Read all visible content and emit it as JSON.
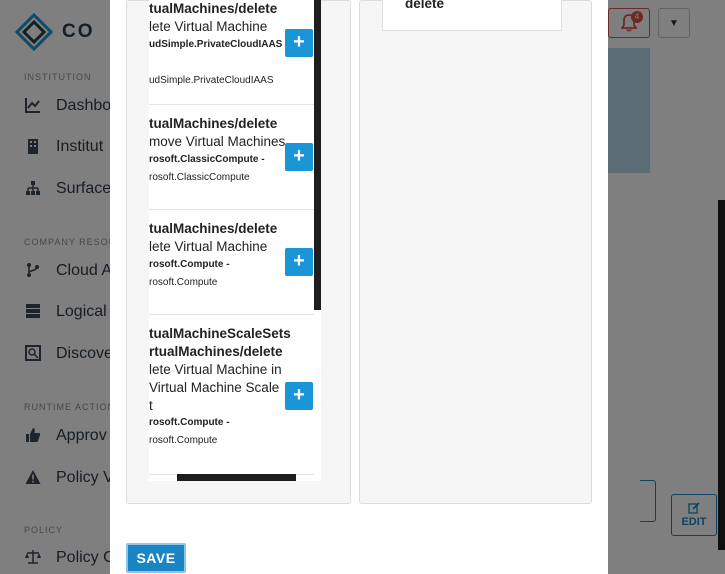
{
  "app": {
    "logo_text": "CO",
    "sidebar": {
      "sections": [
        {
          "title": "INSTITUTION",
          "items": [
            {
              "label": "Dashbo",
              "icon": "chart-line-icon"
            },
            {
              "label": "Institut",
              "icon": "building-icon"
            },
            {
              "label": "Surface",
              "icon": "sitemap-icon"
            }
          ]
        },
        {
          "title": "COMPANY RESOU",
          "items": [
            {
              "label": "Cloud A",
              "icon": "branch-icon"
            },
            {
              "label": "Logical",
              "icon": "server-icon"
            },
            {
              "label": "Discove",
              "icon": "discover-icon"
            }
          ]
        },
        {
          "title": "RUNTIME ACTION",
          "items": [
            {
              "label": "Approv",
              "icon": "thumbs-up-icon"
            },
            {
              "label": "Policy V",
              "icon": "warning-icon"
            }
          ]
        },
        {
          "title": "POLICY",
          "items": [
            {
              "label": "Policy C",
              "icon": "scale-icon"
            }
          ]
        }
      ]
    },
    "notifications_count": "4",
    "edit_label": "EDIT"
  },
  "modal": {
    "operations": [
      {
        "op": "tualMachines/delete",
        "desc": "lete Virtual Machine",
        "prov_bold": "udSimple.PrivateCloudIAAS",
        "prov": "udSimple.PrivateCloudIAAS"
      },
      {
        "op": "tualMachines/delete",
        "desc": "move Virtual Machines",
        "prov_bold": "rosoft.ClassicCompute -",
        "prov": "rosoft.ClassicCompute"
      },
      {
        "op": "tualMachines/delete",
        "desc": "lete Virtual Machine",
        "prov_bold": "rosoft.Compute -",
        "prov": "rosoft.Compute"
      },
      {
        "op": "tualMachineScaleSets",
        "op2": "rtualMachines/delete",
        "desc": "lete Virtual Machine in",
        "desc2": "Virtual Machine Scale",
        "desc3": "t",
        "prov_bold": "rosoft.Compute -",
        "prov": "rosoft.Compute"
      }
    ],
    "selected": [
      {
        "label": "delete"
      }
    ],
    "save_label": "SAVE"
  }
}
